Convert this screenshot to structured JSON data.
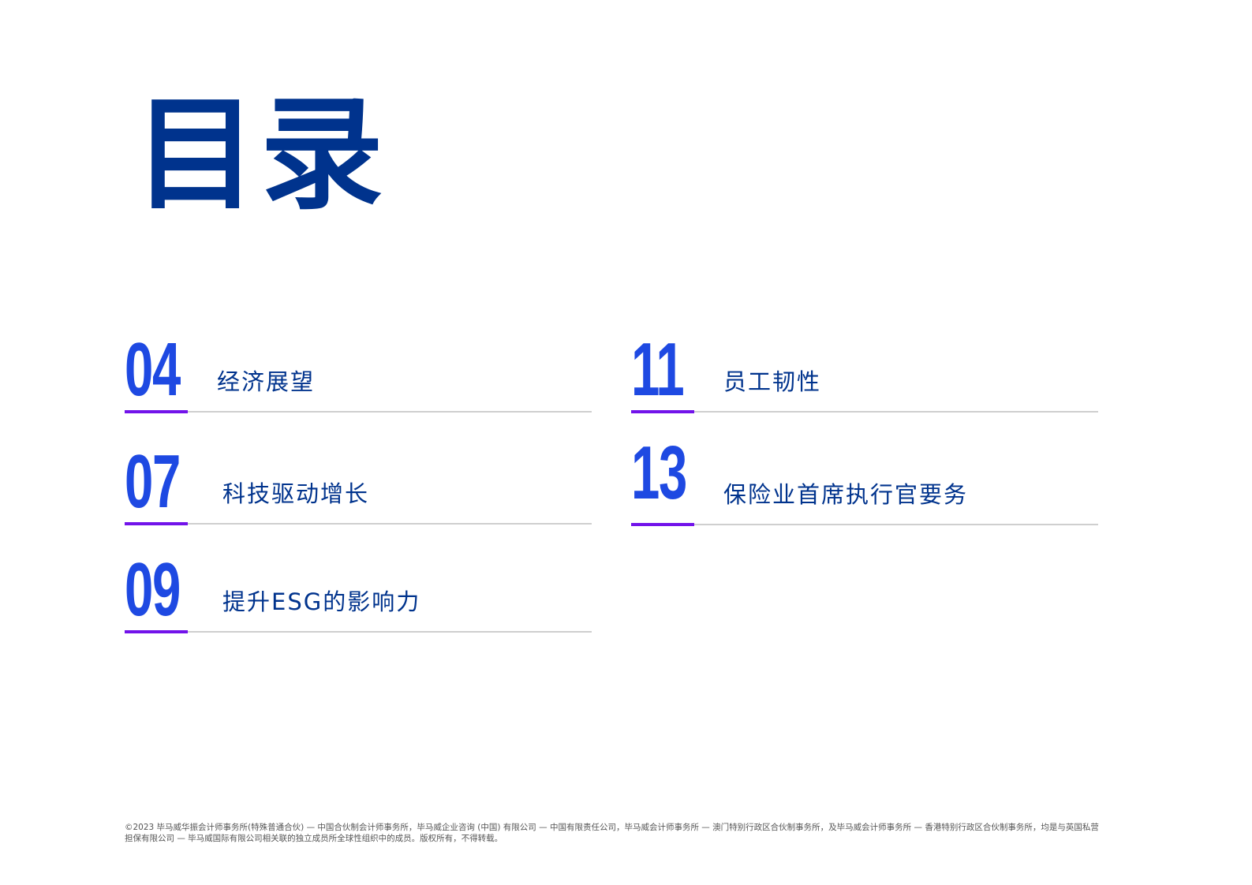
{
  "title": "目录",
  "items": [
    {
      "number": "04",
      "label": "经济展望"
    },
    {
      "number": "07",
      "label": "科技驱动增长"
    },
    {
      "number": "09",
      "label": "提升ESG的影响力"
    },
    {
      "number": "11",
      "label": "员工韧性"
    },
    {
      "number": "13",
      "label": "保险业首席执行官要务"
    }
  ],
  "footer": "©2023 毕马威华振会计师事务所(特殊普通合伙) — 中国合伙制会计师事务所，毕马威企业咨询 (中国) 有限公司 — 中国有限责任公司，毕马威会计师事务所 — 澳门特别行政区合伙制事务所，及毕马威会计师事务所 — 香港特别行政区合伙制事务所，均是与英国私营担保有限公司 — 毕马威国际有限公司相关联的独立成员所全球性组织中的成员。版权所有，不得转载。",
  "colors": {
    "title": "#00338D",
    "number": "#1E49E2",
    "accent": "#7213EA"
  }
}
